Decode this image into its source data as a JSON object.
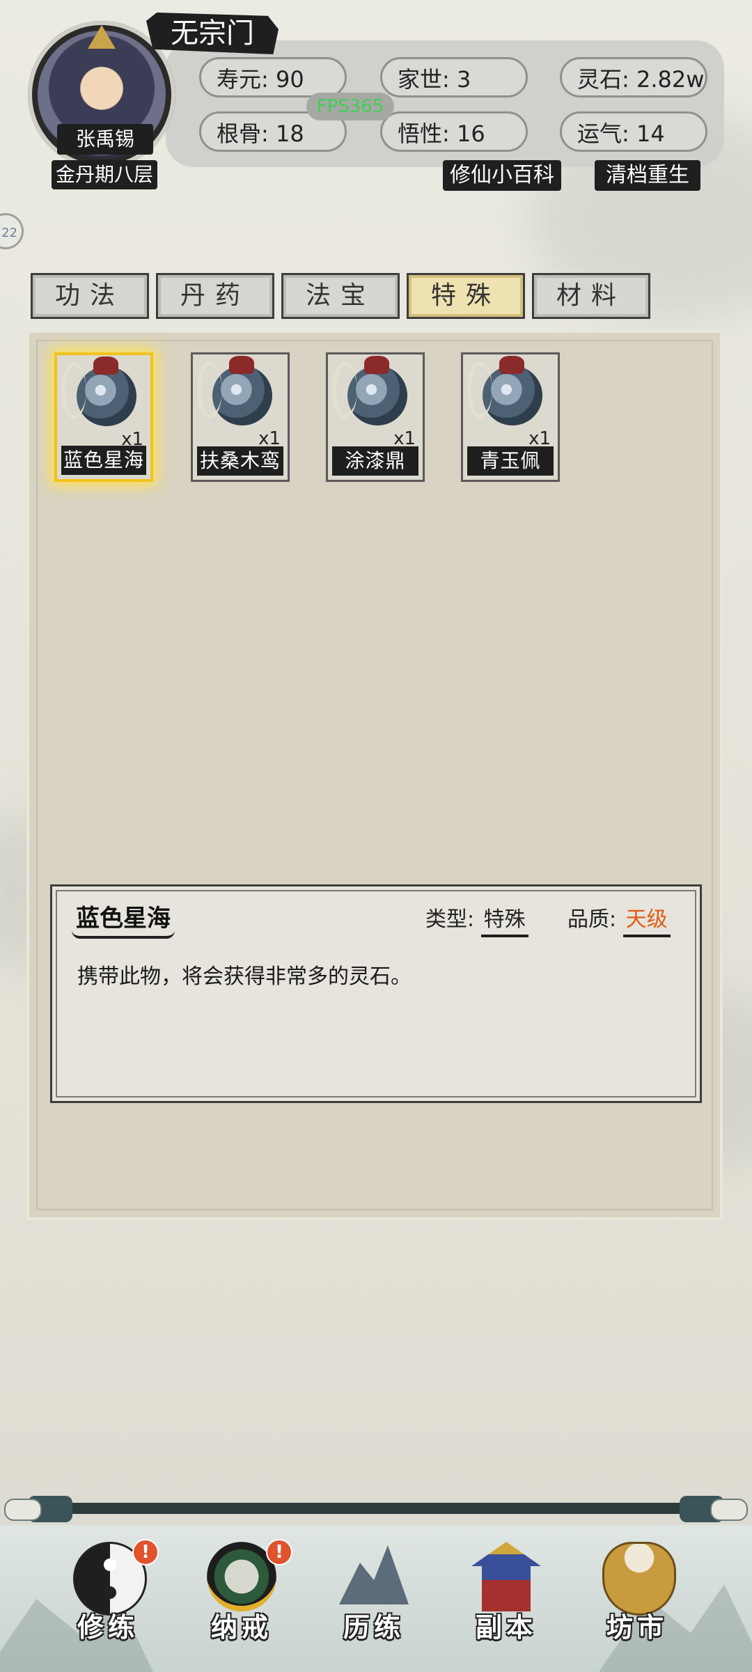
{
  "header": {
    "sect": "无宗门",
    "fps": "FPS365",
    "character": {
      "name": "张禹锡",
      "realm": "金丹期八层"
    },
    "stats": [
      {
        "label": "寿元: 90"
      },
      {
        "label": "家世: 3"
      },
      {
        "label": "灵石: 2.82w"
      },
      {
        "label": "根骨: 18"
      },
      {
        "label": "悟性: 16"
      },
      {
        "label": "运气: 14"
      }
    ],
    "links": {
      "encyclopedia": "修仙小百科",
      "rebirth": "清档重生"
    },
    "edge_badge": "22"
  },
  "tabs": [
    {
      "label": "功法",
      "active": false
    },
    {
      "label": "丹药",
      "active": false
    },
    {
      "label": "法宝",
      "active": false
    },
    {
      "label": "特殊",
      "active": true
    },
    {
      "label": "材料",
      "active": false
    }
  ],
  "items": [
    {
      "name": "蓝色星海",
      "qty": "x1",
      "selected": true,
      "icon": "gourd-icon"
    },
    {
      "name": "扶桑木鸾",
      "qty": "x1",
      "selected": false,
      "icon": "gourd-icon"
    },
    {
      "name": "涂漆鼎",
      "qty": "x1",
      "selected": false,
      "icon": "gourd-icon"
    },
    {
      "name": "青玉佩",
      "qty": "x1",
      "selected": false,
      "icon": "gourd-icon"
    }
  ],
  "detail": {
    "title": "蓝色星海",
    "type_label": "类型:",
    "type_value": "特殊",
    "quality_label": "品质:",
    "quality_value": "天级",
    "description": "携带此物，将会获得非常多的灵石。",
    "quality_color": "#e25a17"
  },
  "nav": [
    {
      "label": "修练",
      "icon": "yin-yang-icon",
      "badge": "!"
    },
    {
      "label": "纳戒",
      "icon": "ring-icon",
      "badge": "!"
    },
    {
      "label": "历练",
      "icon": "mountain-icon",
      "badge": ""
    },
    {
      "label": "副本",
      "icon": "pavilion-icon",
      "badge": ""
    },
    {
      "label": "坊市",
      "icon": "cauldron-icon",
      "badge": ""
    }
  ]
}
